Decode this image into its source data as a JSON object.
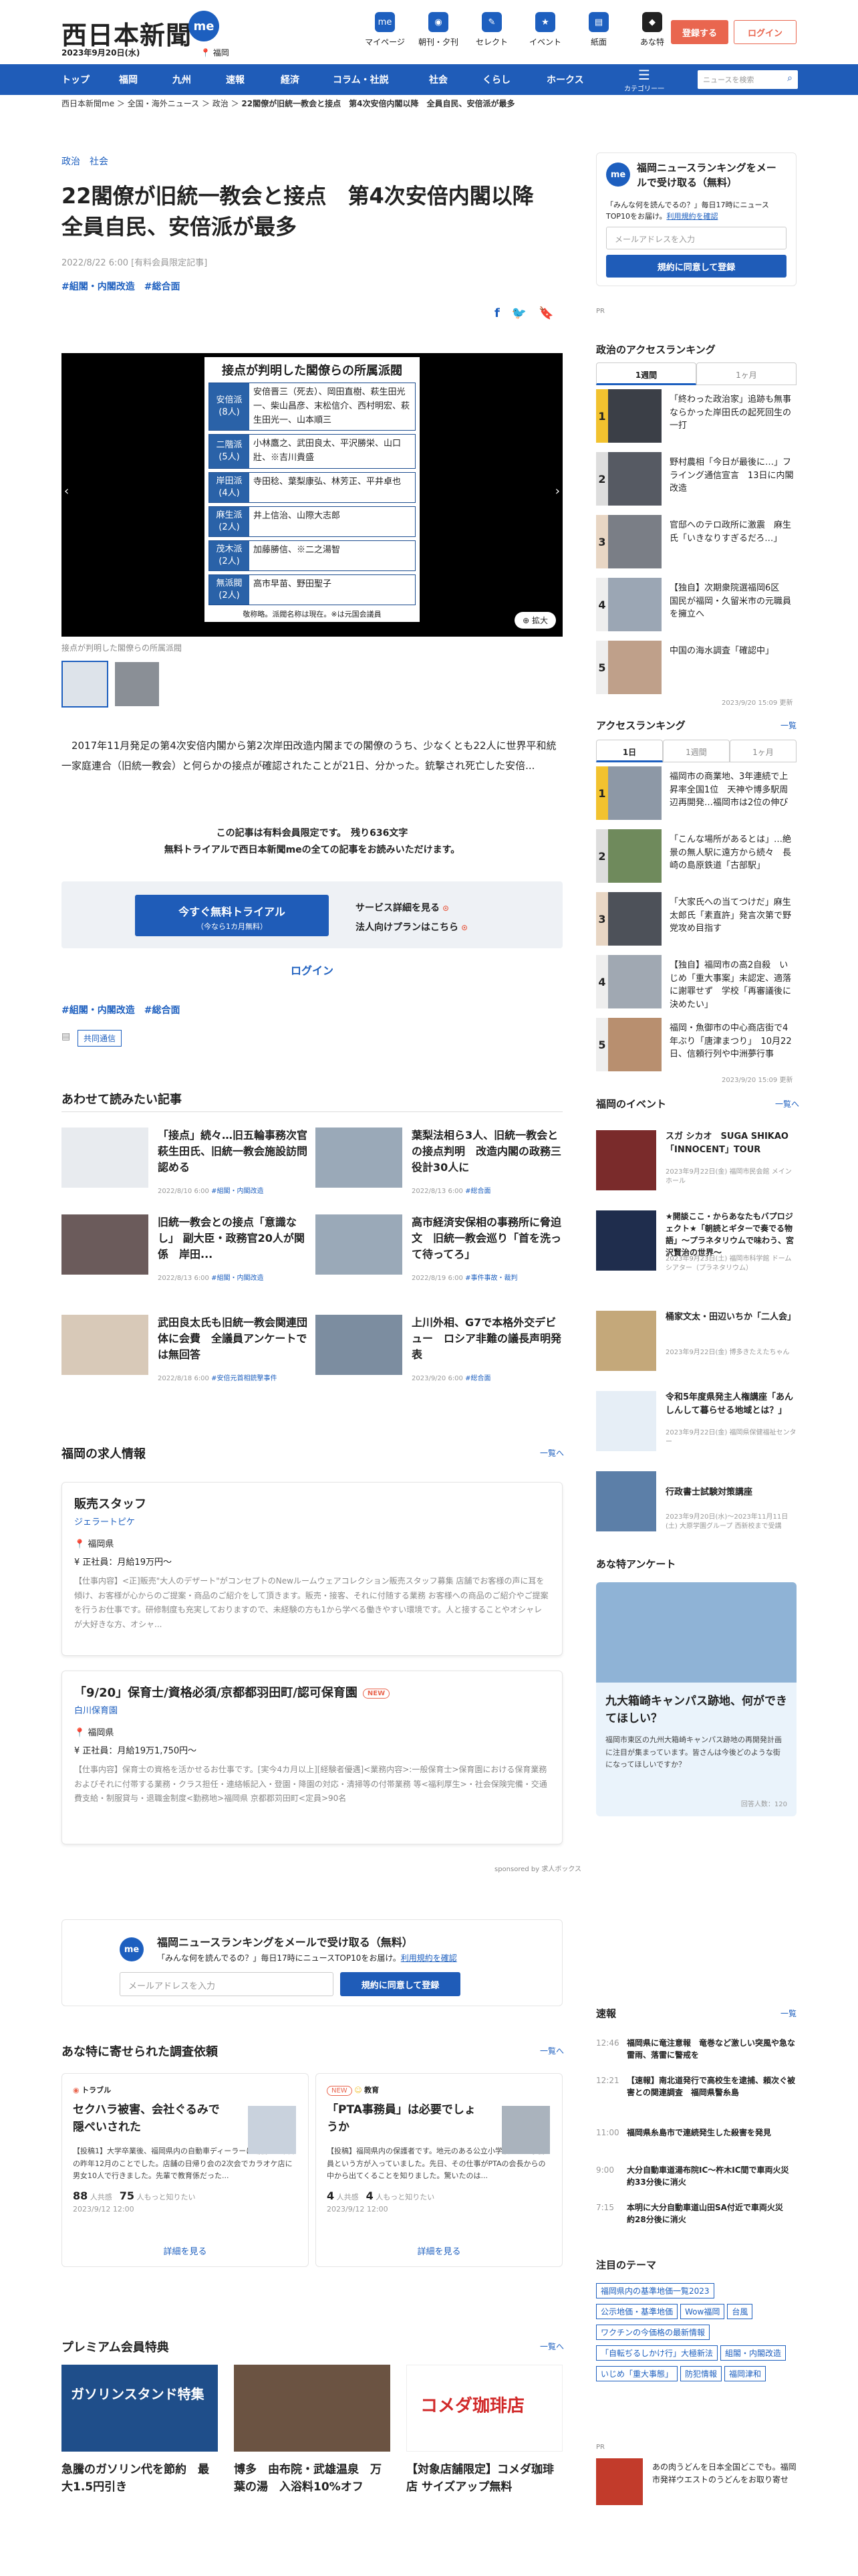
{
  "header": {
    "logo": "西日本新聞",
    "logo_me": "me",
    "date": "2023年9月20日(水)",
    "location": "福岡",
    "icons": [
      {
        "label": "マイページ",
        "glyph": "me"
      },
      {
        "label": "朝刊・夕刊",
        "glyph": "◉"
      },
      {
        "label": "セレクト",
        "glyph": "✎"
      },
      {
        "label": "イベント",
        "glyph": "★"
      },
      {
        "label": "紙面",
        "glyph": "▤"
      },
      {
        "label": "あな特",
        "glyph": "◆"
      }
    ],
    "register": "登録する",
    "login": "ログイン"
  },
  "nav": {
    "items": [
      "トップ",
      "福岡",
      "九州",
      "速報",
      "経済",
      "コラム・社説",
      "社会",
      "くらし",
      "ホークス"
    ],
    "menu_label": "カテゴリー一覧",
    "search_placeholder": "ニュースを検索"
  },
  "breadcrumb": [
    "西日本新聞me",
    "全国・海外ニュース",
    "政治",
    "22閣僚が旧統一教会と接点　第4次安倍内閣以降　全員自民、安倍派が最多"
  ],
  "article": {
    "categories": [
      "政治",
      "社会"
    ],
    "title": "22閣僚が旧統一教会と接点　第4次安倍内閣以降　全員自民、安倍派が最多",
    "meta": "2022/8/22 6:00 [有料会員限定記事]",
    "tags": [
      "#組閣・内閣改造",
      "#総合面"
    ],
    "photo": {
      "heading": "接点が判明した閣僚らの所属派閥",
      "factions": [
        {
          "name": "安倍派",
          "count": "(8人)",
          "members": "安倍晋三（死去）、岡田直樹、萩生田光一、柴山昌彦、末松信介、西村明宏、萩生田光一、山本順三"
        },
        {
          "name": "二階派",
          "count": "(5人)",
          "members": "小林鷹之、武田良太、平沢勝栄、山口壯、※吉川貴盛"
        },
        {
          "name": "岸田派",
          "count": "(4人)",
          "members": "寺田稔、葉梨康弘、林芳正、平井卓也"
        },
        {
          "name": "麻生派",
          "count": "(2人)",
          "members": "井上信治、山際大志郎"
        },
        {
          "name": "茂木派",
          "count": "(2人)",
          "members": "加藤勝信、※二之湯智"
        },
        {
          "name": "無派閥",
          "count": "(2人)",
          "members": "高市早苗、野田聖子"
        }
      ],
      "note": "敬称略。派閥名称は現在。※は元国会議員",
      "enlarge": "拡大"
    },
    "caption": "接点が判明した閣僚らの所属派閥",
    "body": "2017年11月発足の第4次安倍内閣から第2次岸田改造内閣までの閣僚のうち、少なくとも22人に世界平和統一家庭連合（旧統一教会）と何らかの接点が確認されたことが21日、分かった。銃撃され死亡した安倍...",
    "paywall": [
      "この記事は有料会員限定です。　残り636文字",
      "無料トライアルで西日本新聞meの全ての記事をお読みいただけます。"
    ],
    "trial_btn": "今すぐ無料トライアル",
    "trial_sub": "（今なら1カ月無料）",
    "service_link": "サービス詳細を見る",
    "corp_link": "法人向けプランはこちら",
    "login": "ログイン",
    "kyodo": "共同通信"
  },
  "related": {
    "title": "あわせて読みたい記事",
    "items": [
      {
        "text": "「接点」続々…旧五輪事務次官　萩生田氏、旧統一教会施設訪問認める",
        "date": "2022/8/10 6:00",
        "tag": "#組閣・内閣改造"
      },
      {
        "text": "葉梨法相ら3人、旧統一教会との接点判明　改造内閣の政務三役計30人に",
        "date": "2022/8/13 6:00",
        "tag": "#総合面"
      },
      {
        "text": "旧統一教会との接点「意識なし」 副大臣・政務官20人が関係　岸田...",
        "date": "2022/8/13 6:00",
        "tag": "#組閣・内閣改造"
      },
      {
        "text": "高市経済安保相の事務所に脅迫文　旧統一教会巡り「首を洗って待ってろ」",
        "date": "2022/8/19 6:00",
        "tag": "#事件事故・裁判"
      },
      {
        "text": "武田良太氏も旧統一教会関連団体に会費　全議員アンケートでは無回答",
        "date": "2022/8/18 6:00",
        "tag": "#安倍元首相銃撃事件"
      },
      {
        "text": "上川外相、G7で本格外交デビュー　ロシア非難の議長声明発表",
        "date": "2023/9/20 6:00",
        "tag": "#総合面"
      }
    ]
  },
  "jobs": {
    "title": "福岡の求人情報",
    "more": "一覧へ",
    "items": [
      {
        "title": "販売スタッフ",
        "company": "ジェラートピケ",
        "location": "福岡県",
        "salary": "正社員：月給19万円〜",
        "desc": "【仕事内容】<正]販売\"大人のデザート\"がコンセプトのNewルームウェアコレクション販売スタッフ募集 店舗でお客様の声に耳を傾け、お客様が心からのご提案・商品のご紹介をして頂きます。販売・接客、それに付随する業務 お客様への商品のご紹介やご提案を行うお仕事です。研修制度も充実しておりますので、未経験の方も1から学べる働きやすい環境です。人と接することやオシャレが大好きな方、オシャ...",
        "new": ""
      },
      {
        "title": "「9/20」保育士/資格必須/京都都羽田町/認可保育園",
        "company": "白川保育園",
        "location": "福岡県",
        "salary": "正社員：月給19万1,750円〜",
        "desc": "【仕事内容】保育士の資格を活かせるお仕事です。[実今4カ月以上][経験者優遇]<業務内容>:一般保育士>保育園における保育業務およびそれに付帯する業務・クラス担任・連絡帳記入・登園・降園の対応・清掃等の付帯業務 等<福利厚生>・社会保険完備・交通費支給・制服貸与・退職金制度<勤務地>福岡県 京都郡苅田町<定員>90名",
        "new": "NEW"
      }
    ],
    "sponsor": "sponsored by 求人ボックス"
  },
  "mail_wide": {
    "title": "福岡ニュースランキングをメールで受け取る（無料）",
    "sub": "「みんな何を読んでるの？」毎日17時にニュースTOP10をお届け。",
    "terms": "利用規約を確認",
    "placeholder": "メールアドレスを入力",
    "button": "規約に同意して登録"
  },
  "survey": {
    "title": "あな特に寄せられた調査依頼",
    "more": "一覧へ",
    "items": [
      {
        "head": "トラブル",
        "q": "セクハラ被害、会社ぐるみで隠ぺいされた",
        "desc": "【投稿1】大学卒業後、福岡県内の自動車ディーラーに勤務し2年目の昨年12月のことでした。店舗の日帰り会の2次会でカラオケ店に男女10人で行きました。先輩で教育係だった...",
        "stat": "88",
        "stat2": "75",
        "date": "2023/9/12 12:00",
        "link": "詳細を見る"
      },
      {
        "head": "教育",
        "q": "「PTA事務員」は必要でしょうか",
        "desc": "【投稿】福岡県内の保護者です。地元のある公立小学校とPTA事務員という方が入っていました。先日、その仕事がPTAの会長からの中から出てくることを知りました。驚いたのは...",
        "stat": "4",
        "stat2": "4",
        "date": "2023/9/12 12:00",
        "link": "詳細を見る"
      }
    ]
  },
  "premium": {
    "title": "プレミアム会員特典",
    "more": "一覧へ",
    "items": [
      {
        "text": "急騰のガソリン代を節約　最大1.5円引き",
        "img": "ガソリンスタンド特集"
      },
      {
        "text": "博多　由布院・武雄温泉　万葉の湯　入浴料10%オフ",
        "img": ""
      },
      {
        "text": "【対象店舗限定】コメダ珈琲店 サイズアップ無料",
        "img": "コメダ珈琲店"
      }
    ]
  },
  "sidebar": {
    "mail": {
      "title": "福岡ニュースランキングをメールで受け取る（無料）",
      "sub": "「みんな何を読んでるの？」毎日17時にニュースTOP10をお届け。",
      "terms": "利用規約を確認",
      "placeholder": "メールアドレスを入力",
      "button": "規約に同意して登録"
    },
    "pr": "PR",
    "politics_rank": {
      "title": "政治のアクセスランキング",
      "tabs": [
        "1週間",
        "1ヶ月"
      ],
      "items": [
        "「終わった政治家」追跡も無事ならかった岸田氏の起死回生の一打",
        "野村農相「今日が最後に…」フライング通信宣言　13日に内閣改造",
        "官邸へのテロ政所に激震　麻生氏「いきなりすぎるだろ…」",
        "【独自】次期衆院選福岡6区　国民が福岡・久留米市の元職員を擁立へ",
        "中国の海水調査「確認中」"
      ],
      "updated": "2023/9/20 15:09 更新"
    },
    "access_rank": {
      "title": "アクセスランキング",
      "more": "一覧",
      "tabs": [
        "1日",
        "1週間",
        "1ヶ月"
      ],
      "items": [
        "福岡市の商業地、3年連続で上昇率全国1位　天神や博多駅周辺再開発…福岡市は2位の伸び",
        "「こんな場所があるとは」…絶景の無人駅に遠方から続々　長崎の島原鉄道「古部駅」",
        "「大家氏への当てつけだ」麻生太郎氏「素直許」発言次第で野党攻め目指す",
        "【独自】福岡市の高2自殺　いじめ「重大事案」未認定、適落に謝罪せず　学校「再審議後に決めたい」",
        "福岡・魚御市の中心商店街で4年ぶり「唐津まつり」　10月22日、信頼行列や中洲夢行事"
      ],
      "updated": "2023/9/20 15:09 更新"
    },
    "events": {
      "title": "福岡のイベント",
      "more": "一覧へ",
      "items": [
        {
          "text": "スガ シカオ　SUGA SHIKAO 「INNOCENT」TOUR",
          "dt": "2023年9月22日(金) 福岡市民会館 メインホール"
        },
        {
          "text": "★開談ここ・からあなたもバプロジェクト★「朝読とギターで奏でる物語」〜プラネタリウムで味わう、宮沢賢治の世界〜",
          "dt": "2023年9月23日(土) 福岡市科学館 ドームシアター（プラネタリウム）"
        },
        {
          "text": "桶家文太・田辺いちか「二人会」",
          "dt": "2023年9月22日(金) 博多きたえたちゃん"
        },
        {
          "text": "令和5年度県発主人権講座「あんしんして暮らせる地域とは？」",
          "dt": "2023年9月22日(金) 福岡県保健福祉センター"
        },
        {
          "text": "行政書士試験対策講座",
          "dt": "2023年9月20日(水)〜2023年11月11日(土) 大原学園グループ 西新校まで受講"
        }
      ]
    },
    "anatoku": {
      "title": "あな特アンケート",
      "q": "九大箱崎キャンパス跡地、何ができてほしい？",
      "desc": "福岡市東区の九州大箱崎キャンパス跡地の再開発計画に注目が集まっています。皆さんは今後どのような街になってほしいですか？",
      "meta": "回答人数：120"
    },
    "flash": {
      "title": "速報",
      "more": "一覧",
      "items": [
        {
          "t": "12:46",
          "x": "福岡県に竜注意報　竜巻など激しい突風や急な雷雨、落雷に警戒を"
        },
        {
          "t": "12:21",
          "x": "【速報】南北道発行で高校生を逮捕、頼次ぐ被害との関連調査　福岡県警糸島"
        },
        {
          "t": "11:00",
          "x": "福岡県糸島市で連続発生した殺害を発見"
        },
        {
          "t": "9:00",
          "x": "大分自動車道湯布院IC〜杵木IC間で車両火災　約33分後に消火"
        },
        {
          "t": "7:15",
          "x": "本明に大分自動車道山田SA付近で車両火災　約28分後に消火"
        }
      ]
    },
    "topics": {
      "title": "注目のテーマ",
      "tags": [
        "福岡県内の基準地価一覧2023",
        "公示地価・基準地価",
        "Wow福岡",
        "台風",
        "ワクチンの今価格の最新情報",
        "「自転ぢるしかけ行」大極新法",
        "組閣・内閣改造",
        "いじめ「重大事態」",
        "防犯情報",
        "福岡津和"
      ]
    },
    "pr_bottom": "あの肉うどんを日本全国どこでも。福岡市発祥ウエストのうどんをお取り寄せ"
  }
}
